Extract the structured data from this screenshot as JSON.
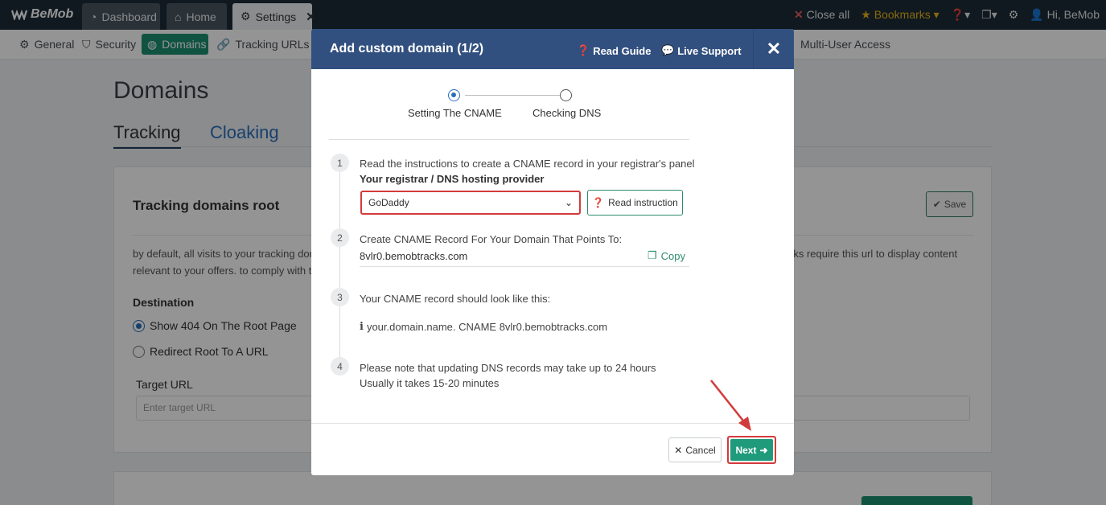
{
  "topbar": {
    "logo": "BeMob",
    "tabs": [
      {
        "label": "Dashboard",
        "icon": "dashboard-icon"
      },
      {
        "label": "Home",
        "icon": "home-icon"
      },
      {
        "label": "Settings",
        "icon": "gear-icon"
      }
    ],
    "close_all": "Close all",
    "bookmarks": "Bookmarks",
    "user": "Hi, BeMob"
  },
  "subnav": {
    "items": [
      {
        "label": "General",
        "icon": "gear-icon"
      },
      {
        "label": "Security",
        "icon": "shield-icon"
      },
      {
        "label": "Domains",
        "icon": "globe-icon"
      },
      {
        "label": "Tracking URLs",
        "icon": "link-icon"
      },
      {
        "label": "Multi-User Access",
        "icon": "users-icon"
      }
    ]
  },
  "page": {
    "title": "Domains",
    "tabs": [
      "Tracking",
      "Cloaking"
    ],
    "card": {
      "title": "Tracking domains root",
      "save": "Save",
      "desc_line1": "by default, all visits to your tracking dor",
      "desc_line2": "relevant to your offers. to comply with t",
      "desc_right": "rks require this url to display content",
      "destination_label": "Destination",
      "options": [
        "Show 404 On The Root Page",
        "Redirect Root To A URL"
      ],
      "target_label": "Target URL",
      "target_placeholder": "Enter target URL"
    }
  },
  "modal": {
    "title": "Add custom domain (1/2)",
    "read_guide": "Read Guide",
    "live_support": "Live Support",
    "steps": [
      "Setting The CNAME",
      "Checking DNS"
    ],
    "step1": {
      "num": "1",
      "text": "Read the instructions to create a CNAME record in your registrar's panel",
      "provider_label": "Your registrar / DNS hosting provider",
      "provider_value": "GoDaddy",
      "read_instruction": "Read instruction"
    },
    "step2": {
      "num": "2",
      "text": "Create CNAME Record For Your Domain That Points To:",
      "domain": "8vlr0.bemobtracks.com",
      "copy": "Copy"
    },
    "step3": {
      "num": "3",
      "text": "Your CNAME record should look like this:",
      "example": "your.domain.name. CNAME 8vlr0.bemobtracks.com"
    },
    "step4": {
      "num": "4",
      "line1": "Please note that updating DNS records may take up to 24 hours",
      "line2": "Usually it takes 15-20 minutes"
    },
    "cancel": "Cancel",
    "next": "Next"
  },
  "colors": {
    "modal_header": "#32507f",
    "primary_green": "#1f9a7a",
    "highlight_red": "#d23b3b",
    "topbar": "#1c2b36"
  }
}
